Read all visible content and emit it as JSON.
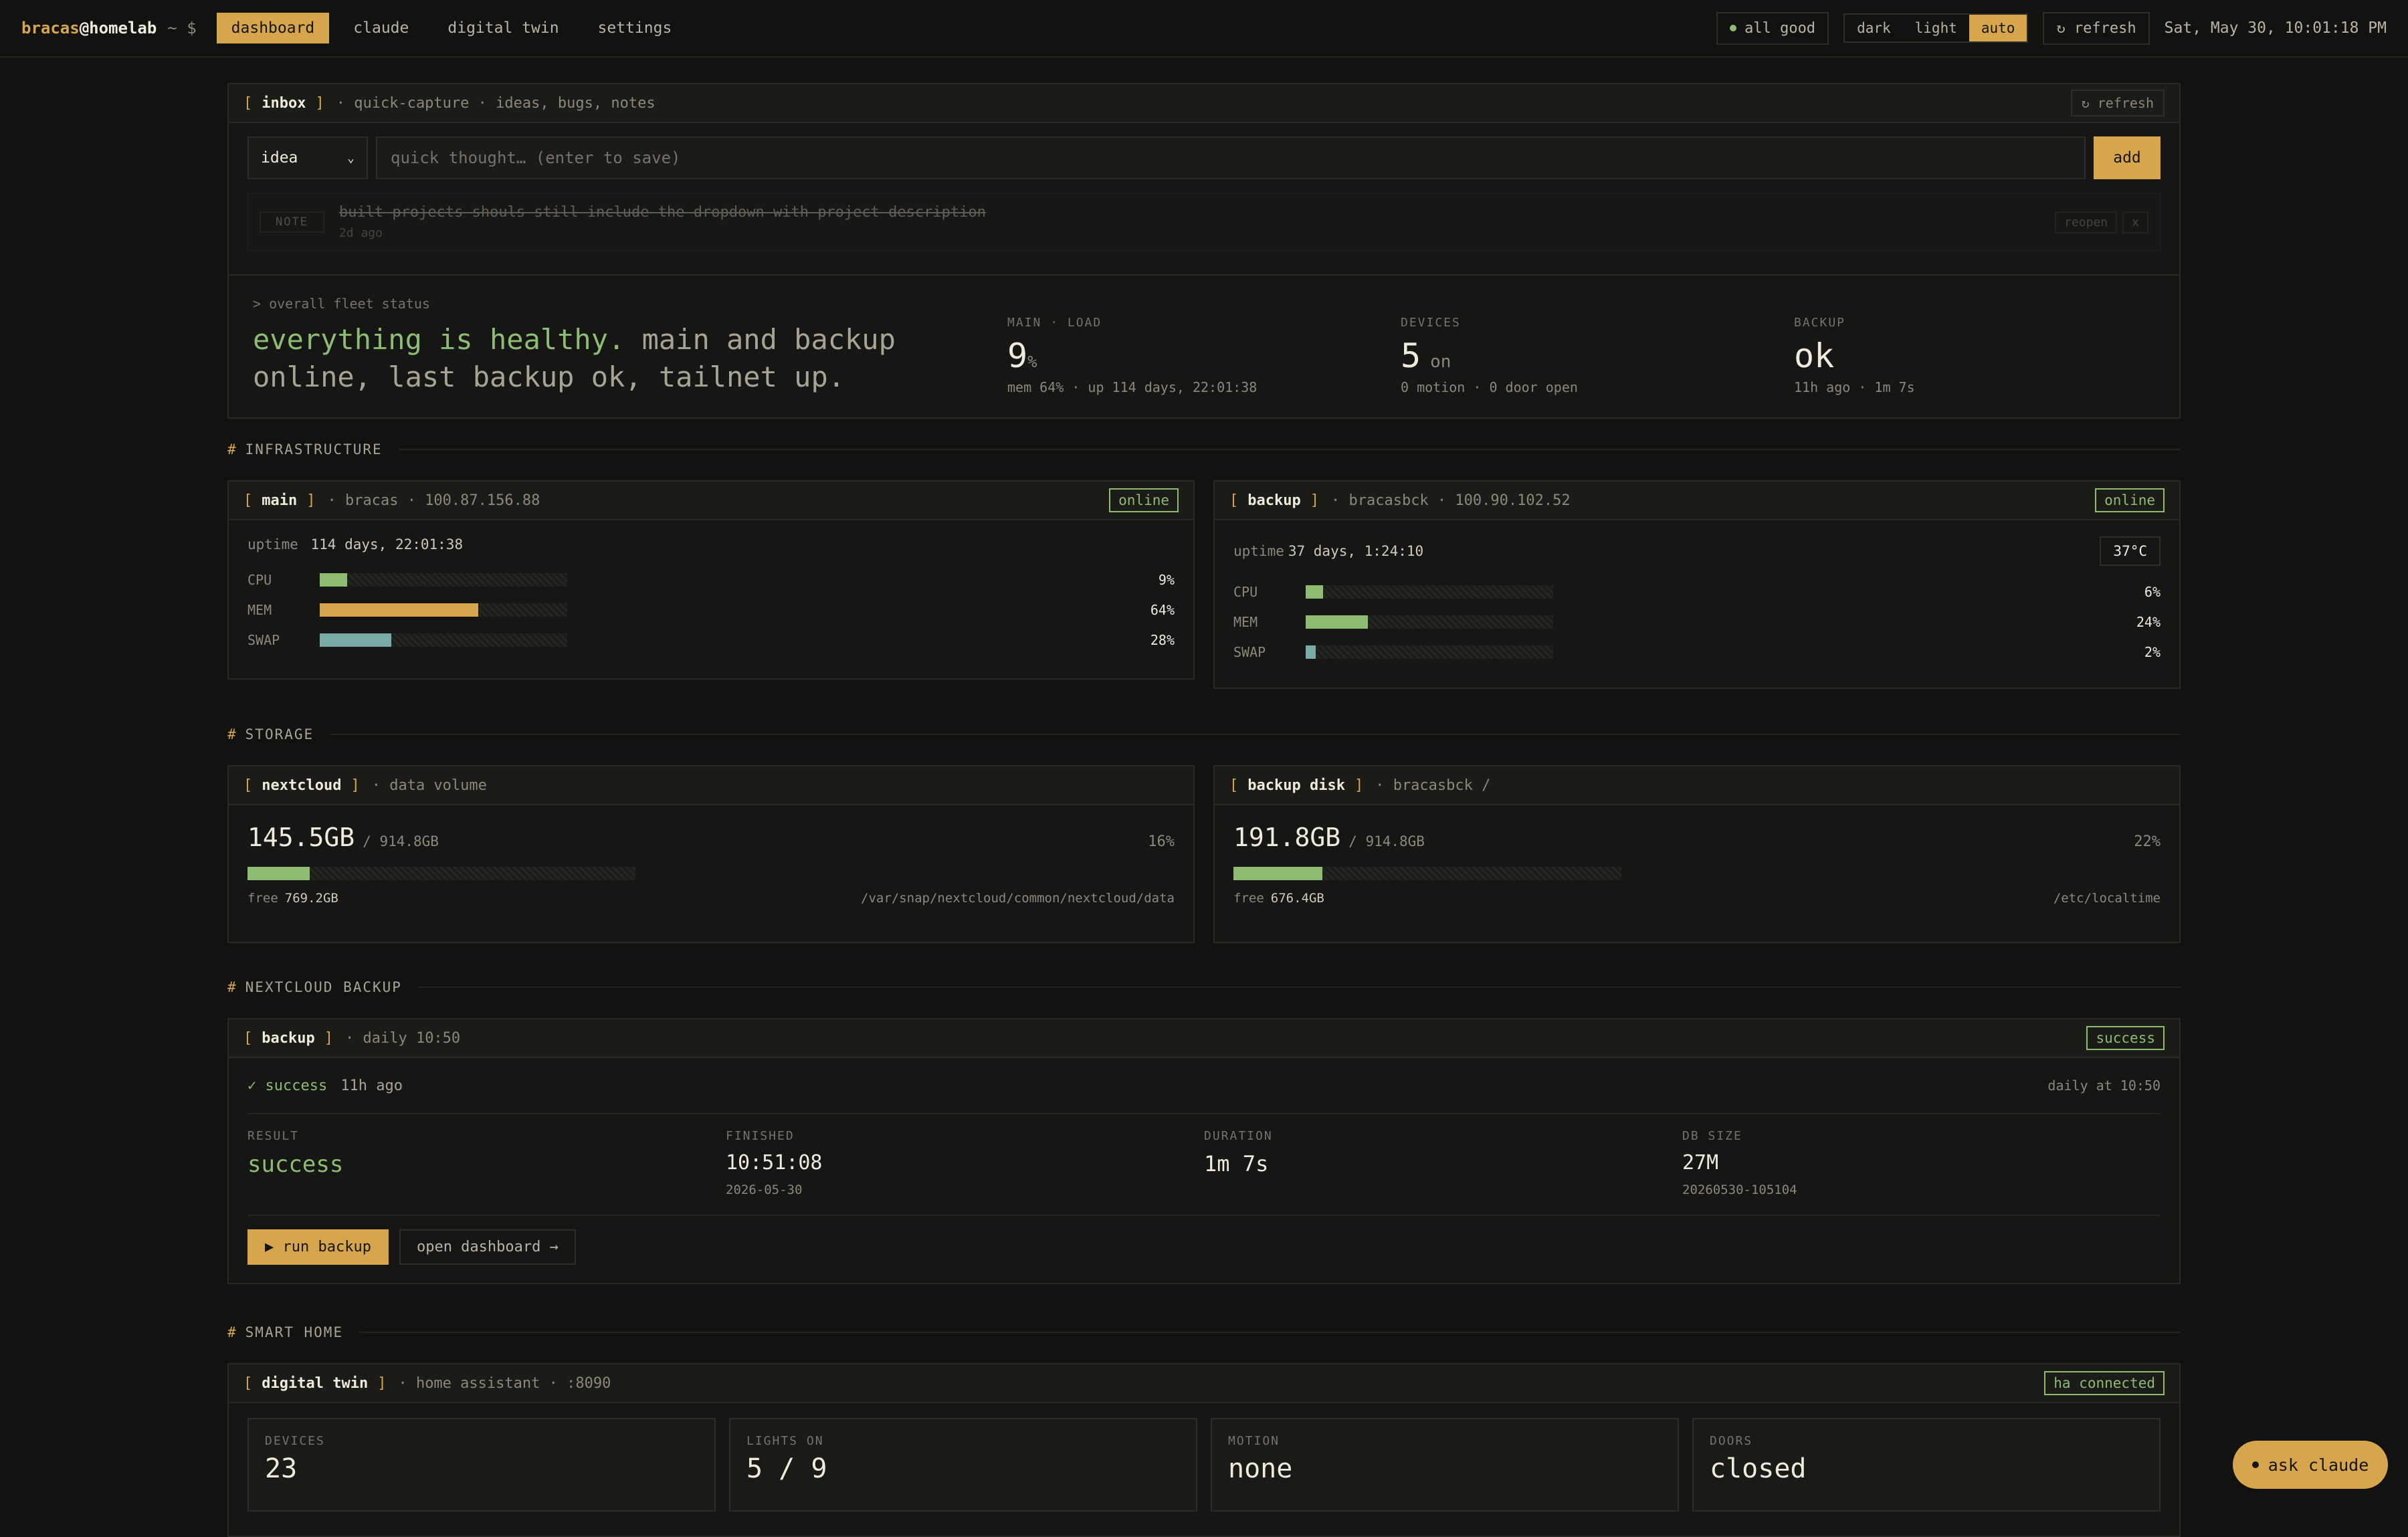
{
  "topbar": {
    "user": "bracas",
    "host": "@homelab",
    "prompt": "~ $",
    "nav": [
      "dashboard",
      "claude",
      "digital twin",
      "settings"
    ],
    "status": "all good",
    "themes": [
      "dark",
      "light",
      "auto"
    ],
    "refresh": "↻ refresh",
    "clock": "Sat, May 30, 10:01:18 PM"
  },
  "inbox": {
    "title": "inbox",
    "subtitle": "· quick-capture · ideas, bugs, notes",
    "refresh": "↻ refresh",
    "select_value": "idea",
    "placeholder": "quick thought… (enter to save)",
    "add": "add",
    "note": {
      "tag": "NOTE",
      "text": "built projects shouls still include the dropdown with project description",
      "age": "2d ago",
      "reopen": "reopen",
      "close": "x"
    }
  },
  "fleet": {
    "label": "> overall fleet status",
    "healthy": "everything is healthy.",
    "rest": " main and backup online, last backup ok, tailnet up.",
    "stats": [
      {
        "label": "MAIN · LOAD",
        "value": "9",
        "unit": "%",
        "sub": "mem 64% · up 114 days, 22:01:38"
      },
      {
        "label": "DEVICES",
        "value": "5",
        "unit": "on",
        "sub": "0 motion · 0 door open"
      },
      {
        "label": "BACKUP",
        "value": "ok",
        "unit": "",
        "sub": "11h ago · 1m 7s"
      }
    ]
  },
  "sections": {
    "infra": "INFRASTRUCTURE",
    "storage": "STORAGE",
    "nextcloud_backup": "NEXTCLOUD BACKUP",
    "smart_home": "SMART HOME"
  },
  "hosts": [
    {
      "name": "main",
      "subtitle": "· bracas · 100.87.156.88",
      "status": "online",
      "uptime_label": "uptime",
      "uptime": "114 days, 22:01:38",
      "temp": "",
      "metrics": [
        {
          "label": "CPU",
          "value": "9%",
          "fraction": 0.11,
          "color": "#8dbd72"
        },
        {
          "label": "MEM",
          "value": "64%",
          "fraction": 0.64,
          "color": "#d7a64c"
        },
        {
          "label": "SWAP",
          "value": "28%",
          "fraction": 0.29,
          "color": "#78aaa8"
        }
      ]
    },
    {
      "name": "backup",
      "subtitle": "· bracasbck · 100.90.102.52",
      "status": "online",
      "uptime_label": "uptime",
      "uptime": "37 days, 1:24:10",
      "temp": "37°C",
      "metrics": [
        {
          "label": "CPU",
          "value": "6%",
          "fraction": 0.07,
          "color": "#8dbd72"
        },
        {
          "label": "MEM",
          "value": "24%",
          "fraction": 0.25,
          "color": "#8dbd72"
        },
        {
          "label": "SWAP",
          "value": "2%",
          "fraction": 0.04,
          "color": "#78aaa8"
        }
      ]
    }
  ],
  "storage": [
    {
      "name": "nextcloud",
      "subtitle": "· data volume",
      "used": "145.5GB",
      "total": "/ 914.8GB",
      "pct": "16%",
      "fraction": 0.16,
      "free_label": "free",
      "free": "769.2GB",
      "path": "/var/snap/nextcloud/common/nextcloud/data"
    },
    {
      "name": "backup disk",
      "subtitle": "· bracasbck /",
      "used": "191.8GB",
      "total": "/ 914.8GB",
      "pct": "22%",
      "fraction": 0.23,
      "free_label": "free",
      "free": "676.4GB",
      "path": "/etc/localtime"
    }
  ],
  "backup": {
    "title": "backup",
    "subtitle": "· daily 10:50",
    "badge": "success",
    "status": "✓ success",
    "ago": "11h ago",
    "schedule": "daily at 10:50",
    "cols": [
      {
        "label": "RESULT",
        "value": "success",
        "sub": ""
      },
      {
        "label": "FINISHED",
        "value": "10:51:08",
        "sub": "2026-05-30"
      },
      {
        "label": "DURATION",
        "value": "1m 7s",
        "sub": ""
      },
      {
        "label": "DB SIZE",
        "value": "27M",
        "sub": "20260530-105104"
      }
    ],
    "run": "▶ run backup",
    "open": "open dashboard →"
  },
  "smarthome": {
    "title": "digital twin",
    "subtitle": "· home assistant · :8090",
    "badge": "ha connected",
    "tiles": [
      {
        "label": "DEVICES",
        "value": "23"
      },
      {
        "label": "LIGHTS ON",
        "value": "5 / 9"
      },
      {
        "label": "MOTION",
        "value": "none"
      },
      {
        "label": "DOORS",
        "value": "closed"
      }
    ]
  },
  "ask": "ask claude",
  "colors": {
    "accent": "#d7a64c",
    "ok": "#8dbd72",
    "swap": "#78aaa8",
    "bg": "#121211"
  }
}
